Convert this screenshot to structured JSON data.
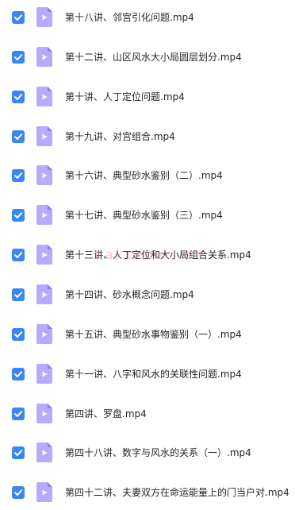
{
  "colors": {
    "checkbox": "#3a86f7",
    "file_icon": "#b9a9ff",
    "file_icon_fold": "#8f7cf2",
    "text": "#1f2329"
  },
  "icons": {
    "checkbox": "checkmark-icon",
    "file": "video-file-icon"
  },
  "watermark": "maxteoeo.ee",
  "files": [
    {
      "name": "第十八讲、邻宫引化问题.mp4",
      "checked": true
    },
    {
      "name": "第十二讲、山区风水大小局圆层划分.mp4",
      "checked": true
    },
    {
      "name": "第十讲、人丁定位问题.mp4",
      "checked": true
    },
    {
      "name": "第十九讲、对宫组合.mp4",
      "checked": true
    },
    {
      "name": "第十六讲、典型砂水鉴别（二）.mp4",
      "checked": true
    },
    {
      "name": "第十七讲、典型砂水鉴别（三）.mp4",
      "checked": true
    },
    {
      "name": "第十三讲、人丁定位和大小局组合关系.mp4",
      "checked": true
    },
    {
      "name": "第十四讲、砂水概念问题.mp4",
      "checked": true
    },
    {
      "name": "第十五讲、典型砂水事物鉴别（一）.mp4",
      "checked": true
    },
    {
      "name": "第十一讲、八字和风水的关联性问题.mp4",
      "checked": true
    },
    {
      "name": "第四讲、罗盘.mp4",
      "checked": true
    },
    {
      "name": "第四十八讲、数字与风水的关系（一）.mp4",
      "checked": true
    },
    {
      "name": "第四十二讲、夫妻双方在命运能量上的门当户对.mp4",
      "checked": true
    }
  ]
}
